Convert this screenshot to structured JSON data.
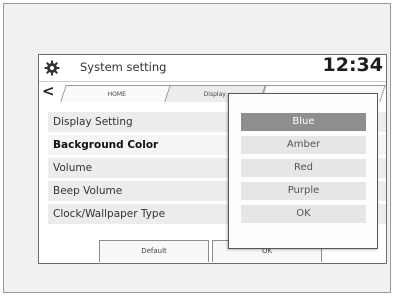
{
  "header": {
    "title": "System setting",
    "clock": "12:34",
    "gear_icon": "gear-icon"
  },
  "tabs": [
    {
      "label": "HOME"
    },
    {
      "label": "Display"
    },
    {
      "label": ""
    }
  ],
  "settings": [
    {
      "label": "Display Setting"
    },
    {
      "label": "Background Color"
    },
    {
      "label": "Volume"
    },
    {
      "label": "Beep Volume"
    },
    {
      "label": "Clock/Wallpaper Type"
    }
  ],
  "buttons": {
    "default_label": "Default",
    "ok_label": "OK"
  },
  "color_menu": {
    "options": [
      "Blue",
      "Amber",
      "Red",
      "Purple",
      "OK"
    ],
    "highlighted": "Blue"
  }
}
